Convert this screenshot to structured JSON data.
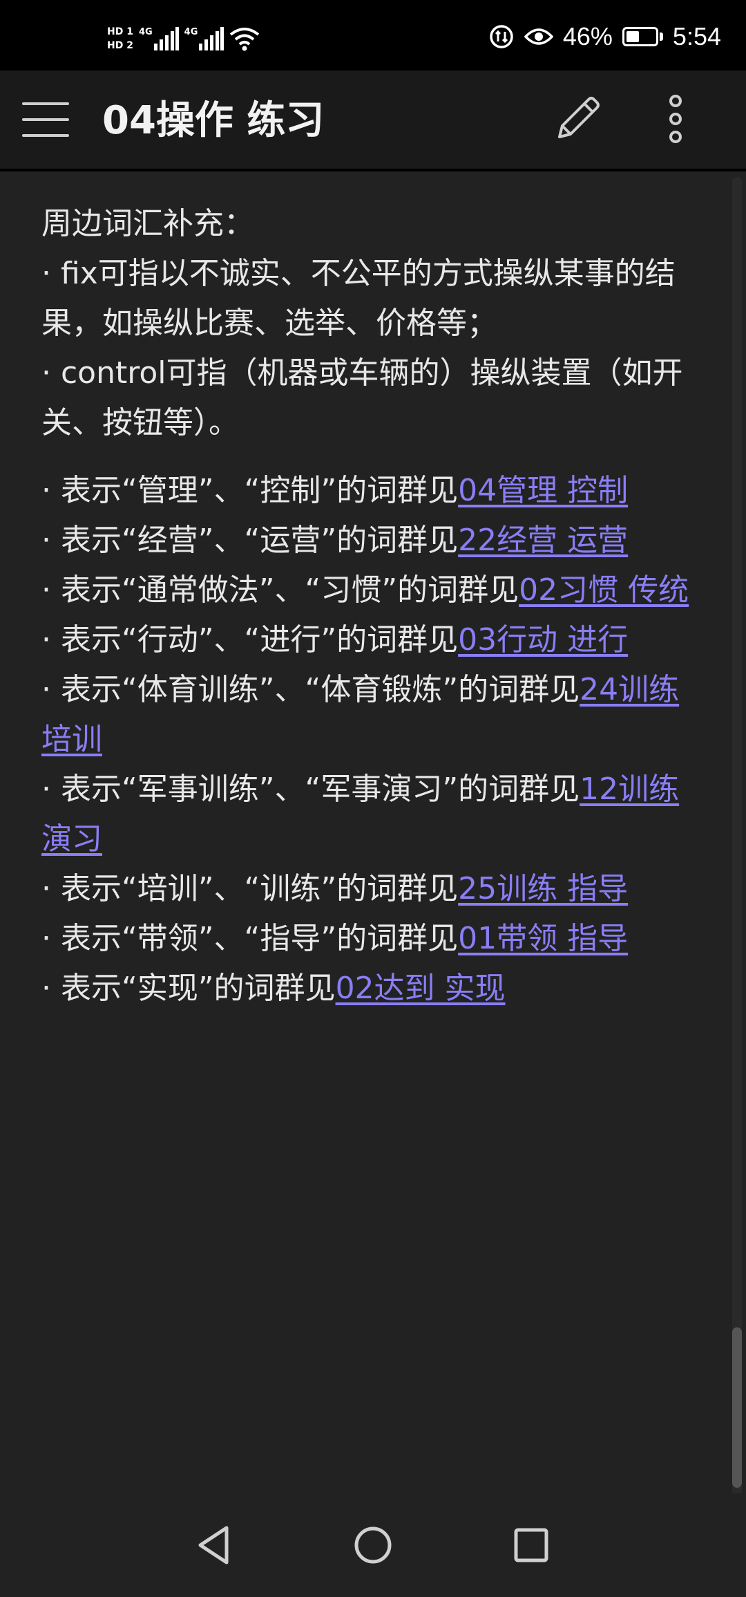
{
  "status_bar": {
    "sim1": "HD 1",
    "sim2": "HD 2",
    "network1": "4G",
    "network2": "4G",
    "battery_percent": "46%",
    "battery_level": 0.46,
    "time": "5:54",
    "icons": [
      "hd-sim-icon",
      "signal-icon",
      "wifi-icon",
      "data-saver-icon",
      "eye-comfort-icon",
      "battery-icon"
    ]
  },
  "app_bar": {
    "title": "04操作 练习",
    "menu_icon": "hamburger-menu-icon",
    "edit_icon": "pencil-icon",
    "more_icon": "more-vertical-icon"
  },
  "note": {
    "intro": "周边词汇补充：",
    "items": [
      "· fix可指以不诚实、不公平的方式操纵某事的结果，如操纵比赛、选举、价格等；",
      "· control可指（机器或车辆的）操纵装置（如开关、按钮等）。"
    ],
    "links": [
      {
        "prefix": "· 表示“管理”、“控制”的词群见",
        "link": "04管理 控制"
      },
      {
        "prefix": "· 表示“经营”、“运营”的词群见",
        "link": "22经营 运营"
      },
      {
        "prefix": "· 表示“通常做法”、“习惯”的词群见",
        "link": "02习惯 传统"
      },
      {
        "prefix": "· 表示“行动”、“进行”的词群见",
        "link": "03行动 进行"
      },
      {
        "prefix": "· 表示“体育训练”、“体育锻炼”的词群见",
        "link": "24训练 培训"
      },
      {
        "prefix": "· 表示“军事训练”、“军事演习”的词群见",
        "link": "12训练 演习"
      },
      {
        "prefix": "· 表示“培训”、“训练”的词群见",
        "link": "25训练 指导"
      },
      {
        "prefix": "· 表示“带领”、“指导”的词群见",
        "link": "01带领 指导"
      },
      {
        "prefix": "· 表示“实现”的词群见",
        "link": "02达到 实现"
      }
    ],
    "link_color": "#8a7ef5"
  },
  "nav_bar": {
    "back_icon": "back-triangle-icon",
    "home_icon": "home-circle-icon",
    "recents_icon": "recents-square-icon"
  }
}
